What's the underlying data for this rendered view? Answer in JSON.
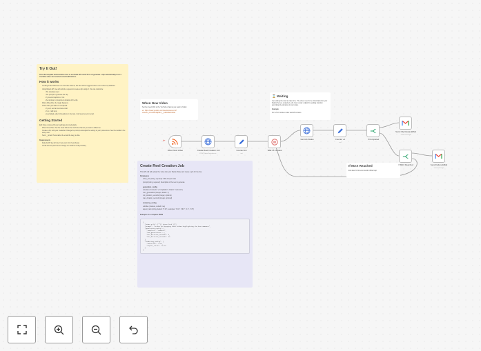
{
  "sticky_intro": {
    "title": "Try It Out!",
    "intro": "This n8n template demonstrates how to use Reka API via HTTP to AI generate a clip automatically from a YouTube video and send an email notifications.",
    "how_title": "How it works",
    "how_items": [
      "Looking at the RSS feed of a YouTube channel, the flow will be triggered when a new video is published.",
      "Using Reka's API, we will submit a request to create a clip using AI. You can customize:",
      "- The template used",
      "- The prompt to generate the clip",
      "- If you want captions or not",
      "- the minimum or maximum duration of the clip.",
      "Wait a little while, the magic happens.",
      "Check if the job status is completed:",
      "- If yes, it sent an success email.",
      "- If no, it will loop.",
      "- As a failsafe, after 10 iterations in the loop, it will send an error email."
    ],
    "start_title": "Getting Started",
    "start_intro": "Edit those nodes with your settings and credentials.",
    "start_items": [
      "When New Video: Set the Feed URL to the YouTube channel you want to follow too.",
      "Create a clip: Add your credential. Change the prompt and adjust the setting to your preferences. See the details in the sticky note.",
      "Send __Email: Personalize the email the way you like."
    ],
    "req_title": "Requirements",
    "req_items": [
      "Reka AI API key (it's free! Get yours from here Reka)",
      "Gmail account (feel free to change it to another email provider)"
    ]
  },
  "sticky_when": {
    "title": "When New Video",
    "text": "Set the Feed URL to the YouTube channel you want to follow",
    "link": "ex: https://www.youtube.com/feeds/videos.xml?channel_id=UCRKISjH8hn__3IIPRPEVN6NA"
  },
  "sticky_wait": {
    "title": "Waiting",
    "text": "Generating the clip can take time. The video need to be downloaded to your Reka's Server, analyzed, edit, then render. Adjust the waiting duration according the duration of your video.",
    "example_title": "Example",
    "example": "For a 5-6 minutes video wait 15 minutes"
  },
  "sticky_max": {
    "title": "If MAX Reached",
    "text": "Exit after 10 times to avoid infinite loop"
  },
  "sticky_create": {
    "title": "Create Reel Creation Job",
    "intro": "This API call will upload the video into your Media library and create a job for the clip.",
    "params_title": "Parameters",
    "params": [
      "video_urls (string, required): URL of input video",
      "prompt (string, required): Description of the reel to generate"
    ],
    "gen_title": "generation_config",
    "gen_items": [
      "template (\"moments\" | \"compilation\", default: \"moments\")",
      "num_generations (integer, default: 1)",
      "min_duration_seconds (integer, optional)",
      "max_duration_seconds (integer, optional)"
    ],
    "render_title": "rendering_config",
    "render_items": [
      "subtitles (boolean, default: true)",
      "aspect_ratio (string, default: \"9:16\"; examples: \"1:16\", \"16:9\", \"1:1\", \"4:5\")"
    ],
    "example_title": "Example of a complete JSON",
    "code": "{\n  \"video_urls\": [\"\"{{ $json.link }}\"],\n  \"prompt\": \"Create an engaging short video highlighting the best moments\",\n  \"generation_config\": {\n    \"template\": \"moments\",\n    \"num_generations\": 1,\n    \"min_duration_seconds\": 0,\n    \"max_duration_seconds\": 30\n  },\n  \"rendering_config\": {\n    \"subtitles\": true,\n    \"aspect_ratio\": \"9:16\"\n  }\n}"
  },
  "nodes": [
    {
      "label": "When New Video",
      "sub": ""
    },
    {
      "label": "Create Reel Creation Job",
      "sub": "POST: https://api.reka.ai..."
    },
    {
      "label": "Counter Init",
      "sub": "set"
    },
    {
      "label": "Wait 15 minutes",
      "sub": ""
    },
    {
      "label": "Get Job Status",
      "sub": ""
    },
    {
      "label": "Counter +1",
      "sub": "set"
    },
    {
      "label": "If Completed",
      "sub": ""
    },
    {
      "label": "Send Clip Ready EMail",
      "sub": "send: message"
    },
    {
      "label": "If MAX Reached",
      "sub": ""
    },
    {
      "label": "Send Failure EMail",
      "sub": "send: message"
    }
  ],
  "controls": [
    "fit-view",
    "zoom-in",
    "zoom-out",
    "undo"
  ],
  "colors": {
    "sticky_yellow": "#fff3c4",
    "sticky_purple": "#e7e6f6",
    "rss": "#f26522",
    "gmail_red": "#ea4335",
    "if_green": "#27a26a",
    "http_blue": "#3b6fd9"
  }
}
